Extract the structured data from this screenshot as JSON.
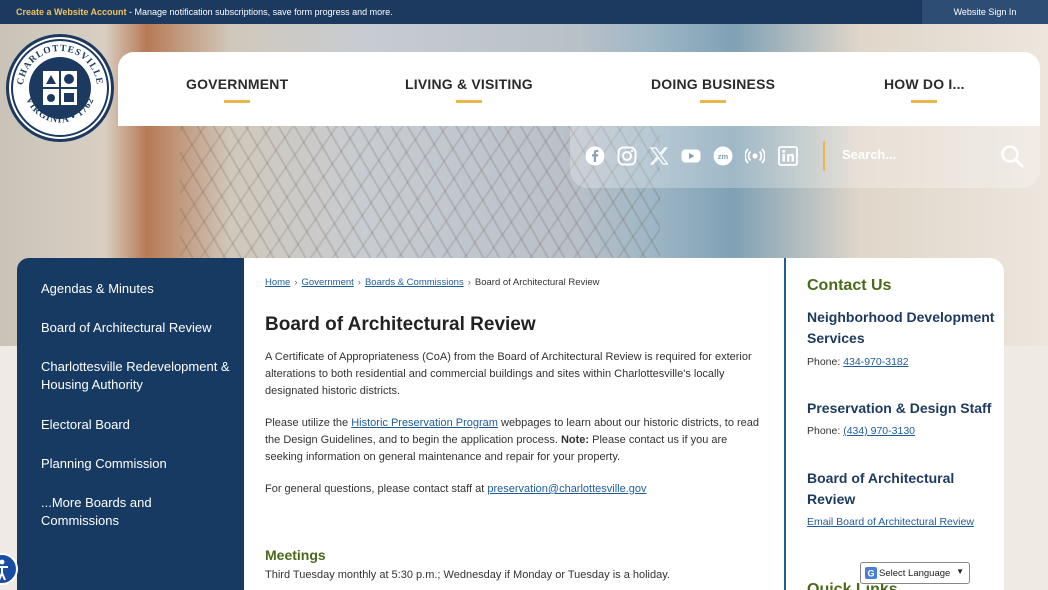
{
  "topbar": {
    "create_link": "Create a Website Account",
    "create_desc": " - Manage notification subscriptions, save form progress and more.",
    "sign_in": "Website Sign In"
  },
  "logo": {
    "top_text": "CHARLOTTESVILLE",
    "bottom_text": "VIRGINIA • 1762"
  },
  "nav": {
    "items": [
      {
        "label": "GOVERNMENT"
      },
      {
        "label": "LIVING & VISITING"
      },
      {
        "label": "DOING BUSINESS"
      },
      {
        "label": "HOW DO I..."
      }
    ]
  },
  "social": {
    "icons": [
      "facebook-icon",
      "instagram-icon",
      "x-icon",
      "youtube-icon",
      "zoom-icon",
      "podcast-icon",
      "linkedin-icon"
    ]
  },
  "search": {
    "placeholder": "Search..."
  },
  "sidebar": {
    "items": [
      {
        "label": "Agendas & Minutes"
      },
      {
        "label": "Board of Architectural Review"
      },
      {
        "label": "Charlottesville Redevelopment & Housing Authority"
      },
      {
        "label": "Electoral Board"
      },
      {
        "label": "Planning Commission"
      },
      {
        "label": "...More Boards and Commissions"
      }
    ]
  },
  "breadcrumb": {
    "home": "Home",
    "government": "Government",
    "boards": "Boards & Commissions",
    "current": "Board of Architectural Review"
  },
  "main": {
    "title": "Board of Architectural Review",
    "para1": "A Certificate of Appropriateness (CoA) from the Board of Architectural Review is required for exterior alterations to both residential and commercial buildings and sites within Charlottesville's locally designated historic districts.",
    "para2_a": "Please utilize the ",
    "para2_link": "Historic Preservation Program",
    "para2_b": " webpages to learn about our historic districts, to read the Design Guidelines, and to begin the application process. ",
    "para2_note": "Note:",
    "para2_c": " Please contact us if you are seeking information on general maintenance and repair for your property.",
    "para3_a": "For general questions, please contact staff at ",
    "para3_link": "preservation@charlottesville.gov",
    "meetings_heading": "Meetings",
    "meetings_text": "Third Tuesday monthly at 5:30 p.m.; Wednesday if Monday or Tuesday is a holiday."
  },
  "contact": {
    "heading": "Contact Us",
    "groups": [
      {
        "name": "Neighborhood Development Services",
        "phone_label": "Phone: ",
        "phone": "434-970-3182"
      },
      {
        "name": "Preservation & Design Staff",
        "phone_label": "Phone: ",
        "phone": "(434) 970-3130"
      },
      {
        "name": "Board of Architectural Review",
        "email_link": "Email Board of Architectural Review"
      }
    ],
    "quick_links": "Quick Links"
  },
  "language": {
    "label": "Select Language"
  },
  "colors": {
    "navy": "#173a63",
    "gold": "#e8b84a",
    "green": "#4a6a1a",
    "link": "#1f5c9c"
  }
}
